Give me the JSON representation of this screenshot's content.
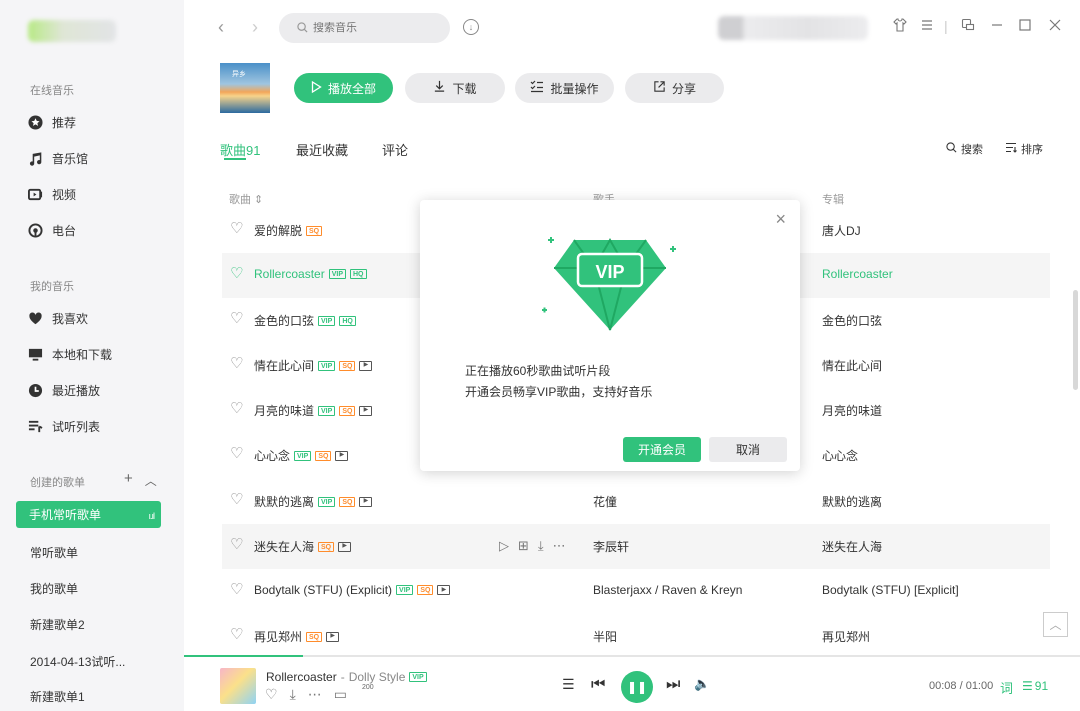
{
  "sidebar": {
    "online_title": "在线音乐",
    "online_items": [
      {
        "label": "推荐",
        "icon": "star-icon"
      },
      {
        "label": "音乐馆",
        "icon": "music-note-icon"
      },
      {
        "label": "视频",
        "icon": "video-icon"
      },
      {
        "label": "电台",
        "icon": "radio-icon"
      }
    ],
    "my_title": "我的音乐",
    "my_items": [
      {
        "label": "我喜欢",
        "icon": "heart-icon"
      },
      {
        "label": "本地和下载",
        "icon": "monitor-icon"
      },
      {
        "label": "最近播放",
        "icon": "clock-icon"
      },
      {
        "label": "试听列表",
        "icon": "playlist-icon"
      }
    ],
    "created_title": "创建的歌单",
    "add_symbol": "+",
    "collapse_symbol": "︿",
    "active_playlist": "手机常听歌单",
    "playing_indicator": "ı.ıl",
    "playlists": [
      "常听歌单",
      "我的歌单",
      "新建歌单2",
      "2014-04-13试听...",
      "新建歌单1"
    ]
  },
  "topbar": {
    "search_placeholder": "搜索音乐",
    "back_symbol": "‹",
    "forward_symbol": "›"
  },
  "header": {
    "cover_text": "异乡",
    "play_all": "播放全部",
    "download": "下载",
    "batch": "批量操作",
    "share": "分享"
  },
  "tabs": {
    "songs": "歌曲91",
    "favorites": "最近收藏",
    "comments": "评论",
    "search": "搜索",
    "sort": "排序"
  },
  "table": {
    "col_song": "歌曲",
    "col_singer": "歌手",
    "col_album": "专辑",
    "rows": [
      {
        "title": "爱的解脱",
        "badges": [
          "SQ"
        ],
        "singer": "",
        "album": "唐人DJ"
      },
      {
        "title": "Rollercoaster",
        "badges": [
          "VIP",
          "HQ"
        ],
        "singer": "",
        "album": "Rollercoaster"
      },
      {
        "title": "金色的口弦",
        "badges": [
          "VIP",
          "HQ"
        ],
        "singer": "",
        "album": "金色的口弦"
      },
      {
        "title": "情在此心间",
        "badges": [
          "VIP",
          "SQ",
          "MV"
        ],
        "singer": "",
        "album": "情在此心间"
      },
      {
        "title": "月亮的味道",
        "badges": [
          "VIP",
          "SQ",
          "MV"
        ],
        "singer": "",
        "album": "月亮的味道"
      },
      {
        "title": "心心念",
        "badges": [
          "VIP",
          "SQ",
          "MV"
        ],
        "singer": "",
        "album": "心心念"
      },
      {
        "title": "默默的逃离",
        "badges": [
          "VIP",
          "SQ",
          "MV"
        ],
        "singer": "花僮",
        "album": "默默的逃离"
      },
      {
        "title": "迷失在人海",
        "badges": [
          "SQ",
          "MV"
        ],
        "singer": "李辰轩",
        "album": "迷失在人海"
      },
      {
        "title": "Bodytalk (STFU) (Explicit)",
        "badges": [
          "VIP",
          "SQ",
          "MV"
        ],
        "singer": "Blasterjaxx / Raven & Kreyn",
        "album": "Bodytalk (STFU) [Explicit]"
      },
      {
        "title": "再见郑州",
        "badges": [
          "SQ",
          "MV"
        ],
        "singer": "半阳",
        "album": "再见郑州"
      }
    ]
  },
  "dialog": {
    "vip_text": "VIP",
    "line1": "正在播放60秒歌曲试听片段",
    "line2": "开通会员畅享VIP歌曲，支持好音乐",
    "confirm": "开通会员",
    "cancel": "取消"
  },
  "player": {
    "progress": 0.133,
    "title": "Rollercoaster",
    "sep": " - ",
    "artist": "Dolly Style",
    "vip_badge": "VIP",
    "comment_count": "200",
    "time": "00:08 / 01:00",
    "lyric_label": "词",
    "queue_count": "91"
  },
  "colors": {
    "accent": "#31c27c",
    "sq_orange": "#ff8c2b",
    "sidebar_bg": "#f5f5f7"
  }
}
